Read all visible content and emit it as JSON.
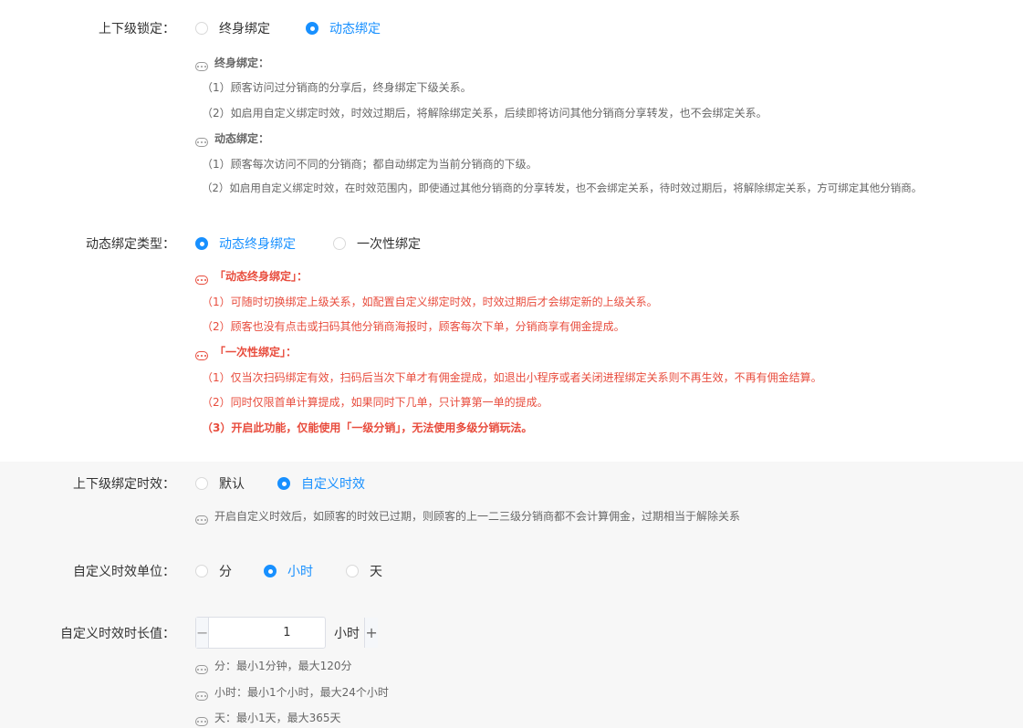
{
  "binding_lock": {
    "label": "上下级锁定：",
    "options": [
      "终身绑定",
      "动态绑定"
    ],
    "help": {
      "lifetime_title": "终身绑定：",
      "lifetime_1": "（1）顾客访问过分销商的分享后，终身绑定下级关系。",
      "lifetime_2": "（2）如启用自定义绑定时效，时效过期后，将解除绑定关系，后续即将访问其他分销商分享转发，也不会绑定关系。",
      "dynamic_title": "动态绑定：",
      "dynamic_1": "（1）顾客每次访问不同的分销商；都自动绑定为当前分销商的下级。",
      "dynamic_2": "（2）如启用自定义绑定时效，在时效范围内，即使通过其他分销商的分享转发，也不会绑定关系，待时效过期后，将解除绑定关系，方可绑定其他分销商。"
    }
  },
  "dynamic_type": {
    "label": "动态绑定类型：",
    "options": [
      "动态终身绑定",
      "一次性绑定"
    ],
    "help": {
      "life_title": "「动态终身绑定」：",
      "life_1": "（1）可随时切换绑定上级关系，如配置自定义绑定时效，时效过期后才会绑定新的上级关系。",
      "life_2": "（2）顾客也没有点击或扫码其他分销商海报时，顾客每次下单，分销商享有佣金提成。",
      "once_title": "「一次性绑定」：",
      "once_1": "（1）仅当次扫码绑定有效，扫码后当次下单才有佣金提成，如退出小程序或者关闭进程绑定关系则不再生效，不再有佣金结算。",
      "once_2": "（2）同时仅限首单计算提成，如果同时下几单，只计算第一单的提成。",
      "once_3": "（3）开启此功能，仅能使用「一级分销」，无法使用多级分销玩法。"
    }
  },
  "validity": {
    "label": "上下级绑定时效：",
    "options": [
      "默认",
      "自定义时效"
    ],
    "help": "开启自定义时效后，如顾客的时效已过期，则顾客的上一二三级分销商都不会计算佣金，过期相当于解除关系"
  },
  "unit": {
    "label": "自定义时效单位：",
    "options": [
      "分",
      "小时",
      "天"
    ]
  },
  "duration": {
    "label": "自定义时效时长值：",
    "value": "1",
    "minus": "−",
    "plus": "+",
    "unit": "小时",
    "help_min": "分：最小1分钟，最大120分",
    "help_hour": "小时：最小1个小时，最大24个小时",
    "help_day": "天：最小1天，最大365天"
  },
  "colors": {
    "primary": "#1890ff",
    "warning": "#e84c3d",
    "section_bg": "#f7f7f7"
  }
}
